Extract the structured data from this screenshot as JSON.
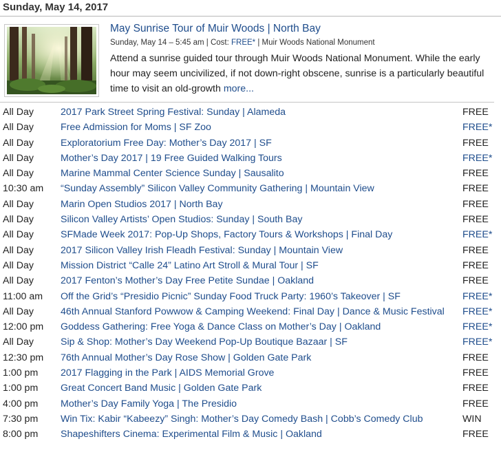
{
  "date_header": "Sunday, May 14, 2017",
  "featured": {
    "title": "May Sunrise Tour of Muir Woods | North Bay",
    "meta_when": "Sunday, May 14 – 5:45 am | Cost: ",
    "meta_cost": "FREE*",
    "meta_where": " | Muir Woods National Monument",
    "description": "Attend a sunrise guided tour through Muir Woods National Monument. While the early hour may seem uncivilized, if not down-right obscene, sunrise is a particularly beautiful time to visit an old-growth ",
    "more_label": "more..."
  },
  "events": [
    {
      "time": "All Day",
      "title": "2017 Park Street Spring Festival: Sunday | Alameda",
      "cost": "FREE",
      "cost_link": false
    },
    {
      "time": "All Day",
      "title": "Free Admission for Moms | SF Zoo",
      "cost": "FREE*",
      "cost_link": true
    },
    {
      "time": "All Day",
      "title": "Exploratorium Free Day: Mother’s Day 2017 | SF",
      "cost": "FREE",
      "cost_link": false
    },
    {
      "time": "All Day",
      "title": "Mother’s Day 2017 | 19 Free Guided Walking Tours",
      "cost": "FREE*",
      "cost_link": true
    },
    {
      "time": "All Day",
      "title": "Marine Mammal Center Science Sunday | Sausalito",
      "cost": "FREE",
      "cost_link": false
    },
    {
      "time": "10:30 am",
      "title": "“Sunday Assembly” Silicon Valley Community Gathering | Mountain View",
      "cost": "FREE",
      "cost_link": false
    },
    {
      "time": "All Day",
      "title": "Marin Open Studios 2017 | North Bay",
      "cost": "FREE",
      "cost_link": false
    },
    {
      "time": "All Day",
      "title": "Silicon Valley Artists’ Open Studios: Sunday | South Bay",
      "cost": "FREE",
      "cost_link": false
    },
    {
      "time": "All Day",
      "title": "SFMade Week 2017: Pop-Up Shops, Factory Tours & Workshops | Final Day",
      "cost": "FREE*",
      "cost_link": true
    },
    {
      "time": "All Day",
      "title": "2017 Silicon Valley Irish Fleadh Festival: Sunday | Mountain View",
      "cost": "FREE",
      "cost_link": false
    },
    {
      "time": "All Day",
      "title": "Mission District “Calle 24” Latino Art Stroll & Mural Tour | SF",
      "cost": "FREE",
      "cost_link": false
    },
    {
      "time": "All Day",
      "title": "2017 Fenton’s Mother’s Day Free Petite Sundae | Oakland",
      "cost": "FREE",
      "cost_link": false
    },
    {
      "time": "11:00 am",
      "title": "Off the Grid’s “Presidio Picnic” Sunday Food Truck Party: 1960’s Takeover | SF",
      "cost": "FREE*",
      "cost_link": true
    },
    {
      "time": "All Day",
      "title": "46th Annual Stanford Powwow & Camping Weekend: Final Day | Dance & Music Festival",
      "cost": "FREE*",
      "cost_link": true
    },
    {
      "time": "12:00 pm",
      "title": "Goddess Gathering: Free Yoga & Dance Class on Mother’s Day | Oakland",
      "cost": "FREE*",
      "cost_link": true
    },
    {
      "time": "All Day",
      "title": "Sip & Shop: Mother’s Day Weekend Pop-Up Boutique Bazaar | SF",
      "cost": "FREE*",
      "cost_link": true
    },
    {
      "time": "12:30 pm",
      "title": "76th Annual Mother’s Day Rose Show | Golden Gate Park",
      "cost": "FREE",
      "cost_link": false
    },
    {
      "time": "1:00 pm",
      "title": "2017 Flagging in the Park | AIDS Memorial Grove",
      "cost": "FREE",
      "cost_link": false
    },
    {
      "time": "1:00 pm",
      "title": "Great Concert Band Music | Golden Gate Park",
      "cost": "FREE",
      "cost_link": false
    },
    {
      "time": "4:00 pm",
      "title": "Mother’s Day Family Yoga | The Presidio",
      "cost": "FREE",
      "cost_link": false
    },
    {
      "time": "7:30 pm",
      "title": "Win Tix: Kabir “Kabeezy” Singh: Mother’s Day Comedy Bash | Cobb’s Comedy Club",
      "cost": "WIN",
      "cost_link": false
    },
    {
      "time": "8:00 pm",
      "title": "Shapeshifters Cinema: Experimental Film & Music | Oakland",
      "cost": "FREE",
      "cost_link": false
    }
  ]
}
